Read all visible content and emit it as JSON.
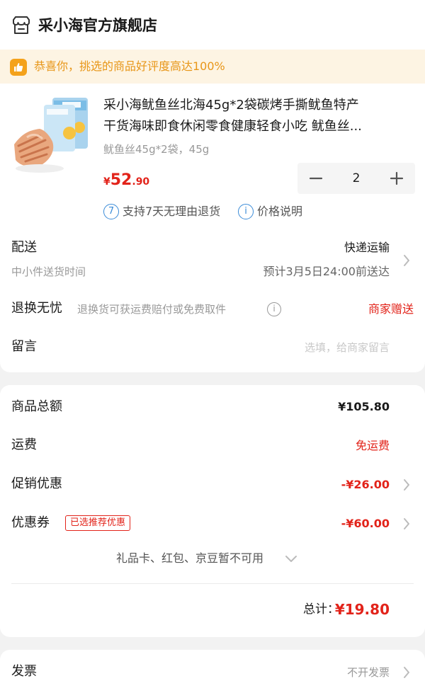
{
  "store": {
    "name": "采小海官方旗舰店",
    "icon": "store-icon"
  },
  "banner": {
    "text": "恭喜你，挑选的商品好评度高达100%",
    "icon": "thumbs-up-icon",
    "accent": "#e89618"
  },
  "product": {
    "title_line1": "采小海鱿鱼丝北海45g*2袋碳烤手撕鱿鱼特产",
    "title_line2": "干货海味即食休闲零食健康轻食小吃 鱿鱼丝...",
    "spec": "鱿鱼丝45g*2袋，45g",
    "price_currency": "¥",
    "price_integer": "52",
    "price_decimal": ".90",
    "quantity": "2"
  },
  "services": {
    "return_badge": "7",
    "return_text": "支持7天无理由退货",
    "price_badge": "i",
    "price_text": "价格说明"
  },
  "delivery": {
    "label": "配送",
    "sub": "中小件送货时间",
    "method": "快递运输",
    "eta": "预计3月5日24:00前送达"
  },
  "return_worry": {
    "label": "退换无忧",
    "desc": "退换货可获运费赔付或免费取件",
    "value": "商家赠送"
  },
  "note": {
    "label": "留言",
    "placeholder": "选填，给商家留言"
  },
  "fees": {
    "goods_total_label": "商品总额",
    "goods_total_value": "¥105.80",
    "shipping_label": "运费",
    "shipping_value": "免运费",
    "promo_label": "促销优惠",
    "promo_value": "-¥26.00",
    "coupon_label": "优惠券",
    "coupon_tag": "已选推荐优惠",
    "coupon_value": "-¥60.00",
    "unavailable_text": "礼品卡、红包、京豆暂不可用",
    "total_label": "总计：",
    "total_value": "¥19.80"
  },
  "invoice": {
    "label": "发票",
    "value": "不开发票"
  },
  "colors": {
    "red": "#e2231a",
    "orange": "#e89618",
    "blue": "#3a8bd8"
  }
}
